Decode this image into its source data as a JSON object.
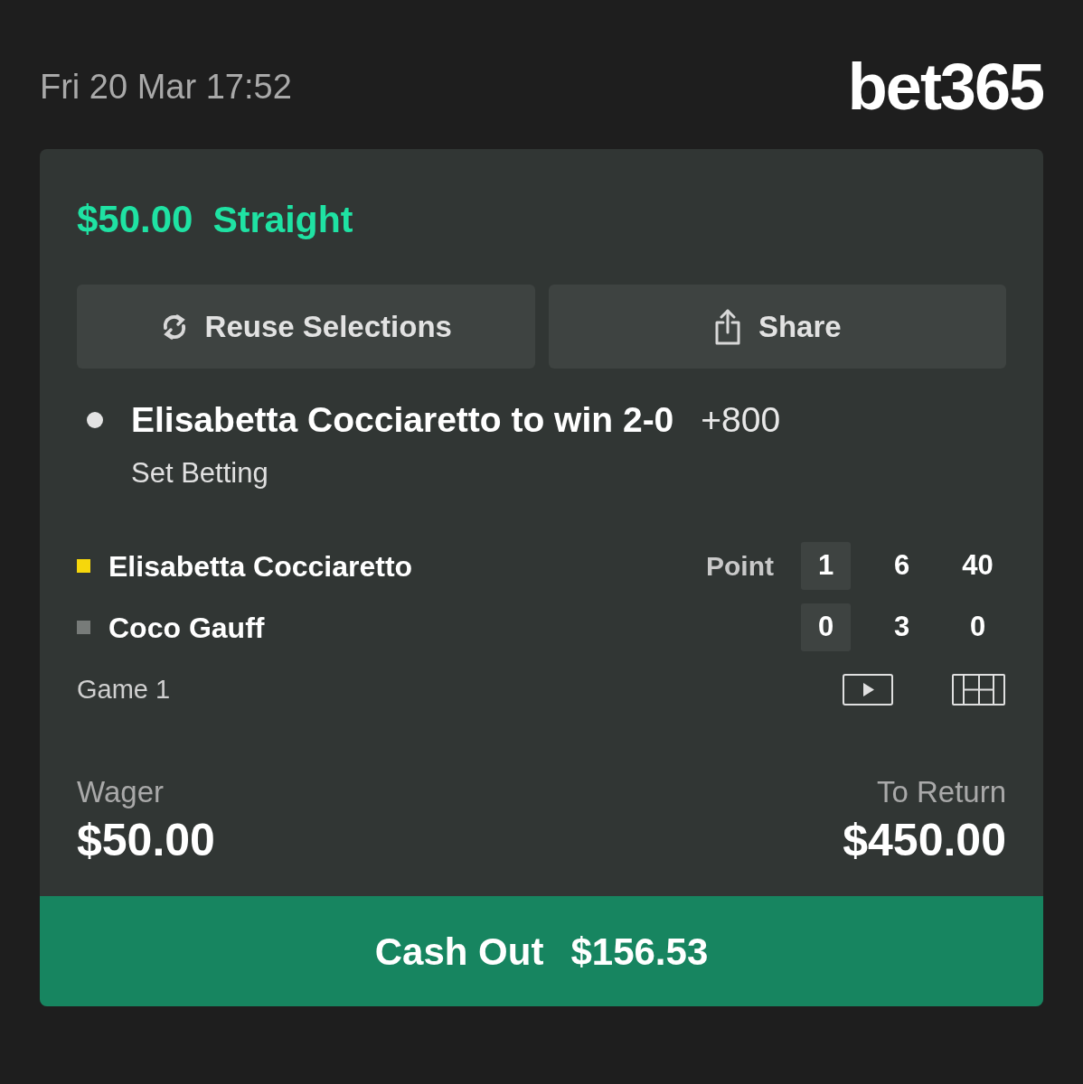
{
  "header": {
    "datetime": "Fri 20 Mar 17:52",
    "logo": "bet365"
  },
  "bet": {
    "stake": "$50.00",
    "type": "Straight"
  },
  "actions": [
    {
      "kind": "reuse",
      "label": "Reuse Selections"
    },
    {
      "kind": "share",
      "label": "Share"
    }
  ],
  "selection": {
    "title": "Elisabetta Cocciaretto to win 2-0",
    "odds": "+800",
    "market": "Set Betting"
  },
  "scoreboard": {
    "point_label": "Point",
    "players": [
      {
        "name": "Elisabetta Cocciaretto",
        "serving": true,
        "scores": [
          "1",
          "6",
          "40"
        ]
      },
      {
        "name": "Coco Gauff",
        "serving": false,
        "scores": [
          "0",
          "3",
          "0"
        ]
      }
    ],
    "status": "Game 1"
  },
  "wager": {
    "label": "Wager",
    "value": "$50.00"
  },
  "to_return": {
    "label": "To Return",
    "value": "$450.00"
  },
  "cash_out": {
    "label": "Cash Out",
    "amount": "$156.53"
  }
}
